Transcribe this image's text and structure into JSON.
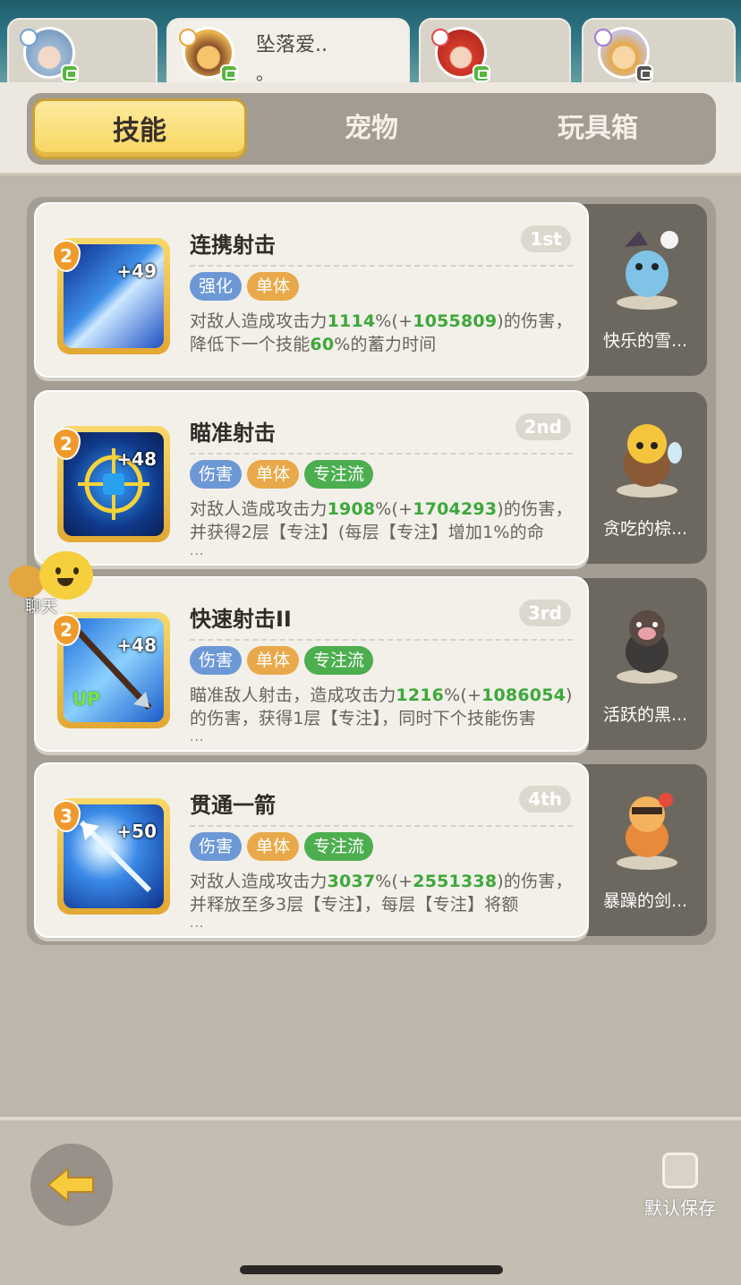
{
  "character_tabs": [
    {
      "name": "",
      "sub": "",
      "active": false
    },
    {
      "name": "坠落爱..",
      "sub": "。",
      "active": true
    },
    {
      "name": "",
      "sub": "",
      "active": false
    },
    {
      "name": "",
      "sub": "",
      "active": false
    }
  ],
  "segments": {
    "skills": "技能",
    "pets": "宠物",
    "toybox": "玩具箱"
  },
  "chat_bubble": "聊天",
  "skills": [
    {
      "title": "连携射击",
      "rank": "1st",
      "level": "2",
      "bonus": "+49",
      "tags": [
        "强化",
        "单体"
      ],
      "desc": {
        "p1": "对敌人造成攻击力",
        "v1": "1114",
        "p2": "%(+",
        "v2": "1055809",
        "p3": ")的伤害，降低下一个技能",
        "v3": "60",
        "p4": "%的蓄力时间"
      },
      "pet_name": "快乐的雪..."
    },
    {
      "title": "瞄准射击",
      "rank": "2nd",
      "level": "2",
      "bonus": "+48",
      "tags": [
        "伤害",
        "单体",
        "专注流"
      ],
      "desc": {
        "p1": "对敌人造成攻击力",
        "v1": "1908",
        "p2": "%(+",
        "v2": "1704293",
        "p3": ")的伤害，并获得2层【专注】(每层【专注】增加1%的命",
        "v3": "",
        "p4": ""
      },
      "pet_name": "贪吃的棕..."
    },
    {
      "title": "快速射击II",
      "rank": "3rd",
      "level": "2",
      "bonus": "+48",
      "up": "UP",
      "tags": [
        "伤害",
        "单体",
        "专注流"
      ],
      "desc": {
        "p1": "瞄准敌人射击，造成攻击力",
        "v1": "1216",
        "p2": "%(+",
        "v2": "1086054",
        "p3": ")的伤害，获得1层【专注】，同时下个技能伤害",
        "v3": "",
        "p4": ""
      },
      "pet_name": "活跃的黑..."
    },
    {
      "title": "贯通一箭",
      "rank": "4th",
      "level": "3",
      "bonus": "+50",
      "tags": [
        "伤害",
        "单体",
        "专注流"
      ],
      "desc": {
        "p1": "对敌人造成攻击力",
        "v1": "3037",
        "p2": "%(+",
        "v2": "2551338",
        "p3": ")的伤害，并释放至多3层【专注】，每层【专注】将额",
        "v3": "",
        "p4": ""
      },
      "pet_name": "暴躁的剑..."
    }
  ],
  "more_marker": "...",
  "footer": {
    "default_save_label": "默认保存"
  },
  "colors": {
    "accent": "#f8d65c",
    "green_value": "#3da83a",
    "tag_blue": "#6d98d6",
    "tag_orange": "#e9a94a",
    "tag_green": "#4cae4f"
  }
}
